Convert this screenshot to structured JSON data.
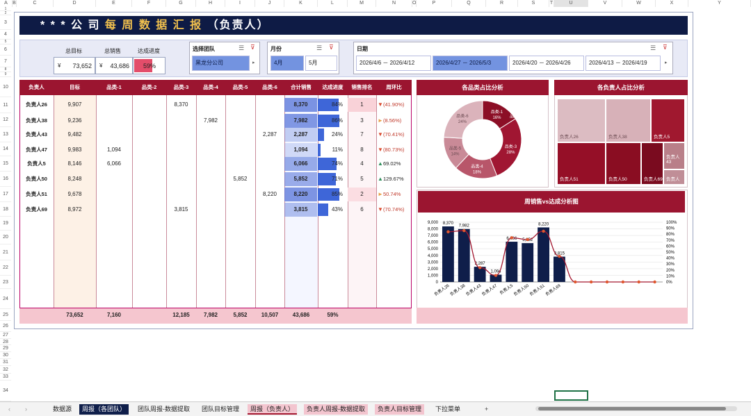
{
  "columns": [
    "A",
    "B",
    "C",
    "D",
    "E",
    "F",
    "G",
    "H",
    "I",
    "J",
    "K",
    "L",
    "M",
    "N",
    "O",
    "P",
    "Q",
    "R",
    "S",
    "T",
    "U",
    "V",
    "W",
    "X",
    "Y"
  ],
  "rows": [
    "1",
    "2",
    "3",
    "4",
    "5",
    "6",
    "7",
    "8",
    "9",
    "10",
    "11",
    "12",
    "13",
    "14",
    "15",
    "16",
    "17",
    "18",
    "19",
    "20",
    "21",
    "22",
    "23",
    "24",
    "25",
    "26",
    "27",
    "28",
    "29",
    "30",
    "31",
    "32",
    "33",
    "34"
  ],
  "title": {
    "stars": "* * * 公 司 ",
    "highlight": "每 周 数 据 汇 报",
    "suffix": "（负责人）"
  },
  "kpi": {
    "target_label": "总目标",
    "sales_label": "总销售",
    "progress_label": "达成进度",
    "currency": "¥",
    "target": "73,652",
    "sales": "43,686",
    "progress": "59%",
    "progress_value": 0.59
  },
  "team_slicer": {
    "title": "选择团队",
    "selected": "黑龙分公司"
  },
  "month_slicer": {
    "title": "月份",
    "items": [
      "4月",
      "5月"
    ],
    "selected": "4月"
  },
  "date_slicer": {
    "title": "日期",
    "items": [
      "2026/4/6 － 2026/4/12",
      "2026/4/27 － 2026/5/3",
      "2026/4/20 － 2026/4/26",
      "2026/4/13 － 2026/4/19"
    ],
    "selected": 1
  },
  "table": {
    "headers": [
      "负责人",
      "目标",
      "品类-1",
      "品类-2",
      "品类-3",
      "品类-4",
      "品类-5",
      "品类-6",
      "合计销售",
      "达成进度",
      "销售排名",
      "周环比"
    ],
    "rows": [
      {
        "name": "负责人26",
        "target": "9,907",
        "c1": "",
        "c2": "",
        "c3": "8,370",
        "c4": "",
        "c5": "",
        "c6": "",
        "total": "8,370",
        "pct": "84%",
        "pctv": 0.84,
        "rank": "1",
        "wow": "(41.90%)",
        "dir": "down"
      },
      {
        "name": "负责人38",
        "target": "9,236",
        "c1": "",
        "c2": "",
        "c3": "",
        "c4": "7,982",
        "c5": "",
        "c6": "",
        "total": "7,982",
        "pct": "86%",
        "pctv": 0.86,
        "rank": "3",
        "wow": "(8.56%)",
        "dir": "side"
      },
      {
        "name": "负责人43",
        "target": "9,482",
        "c1": "",
        "c2": "",
        "c3": "",
        "c4": "",
        "c5": "",
        "c6": "2,287",
        "total": "2,287",
        "pct": "24%",
        "pctv": 0.24,
        "rank": "7",
        "wow": "(70.41%)",
        "dir": "down"
      },
      {
        "name": "负责人47",
        "target": "9,983",
        "c1": "1,094",
        "c2": "",
        "c3": "",
        "c4": "",
        "c5": "",
        "c6": "",
        "total": "1,094",
        "pct": "11%",
        "pctv": 0.11,
        "rank": "8",
        "wow": "(80.73%)",
        "dir": "down"
      },
      {
        "name": "负责人5",
        "target": "8,146",
        "c1": "6,066",
        "c2": "",
        "c3": "",
        "c4": "",
        "c5": "",
        "c6": "",
        "total": "6,066",
        "pct": "74%",
        "pctv": 0.74,
        "rank": "4",
        "wow": "69.02%",
        "dir": "up"
      },
      {
        "name": "负责人50",
        "target": "8,248",
        "c1": "",
        "c2": "",
        "c3": "",
        "c4": "",
        "c5": "5,852",
        "c6": "",
        "total": "5,852",
        "pct": "71%",
        "pctv": 0.71,
        "rank": "5",
        "wow": "129.67%",
        "dir": "up"
      },
      {
        "name": "负责人51",
        "target": "9,678",
        "c1": "",
        "c2": "",
        "c3": "",
        "c4": "",
        "c5": "",
        "c6": "8,220",
        "total": "8,220",
        "pct": "85%",
        "pctv": 0.85,
        "rank": "2",
        "wow": "50.74%",
        "dir": "side"
      },
      {
        "name": "负责人69",
        "target": "8,972",
        "c1": "",
        "c2": "",
        "c3": "3,815",
        "c4": "",
        "c5": "",
        "c6": "",
        "total": "3,815",
        "pct": "43%",
        "pctv": 0.43,
        "rank": "6",
        "wow": "(70.74%)",
        "dir": "down"
      }
    ],
    "totals": {
      "target": "73,652",
      "c1": "7,160",
      "c2": "",
      "c3": "12,185",
      "c4": "7,982",
      "c5": "5,852",
      "c6": "10,507",
      "total": "43,686",
      "pct": "59%"
    }
  },
  "donut": {
    "title": "各品类占比分析",
    "slices": [
      {
        "label": "品类-1",
        "pct": "16%",
        "value": 0.16,
        "color": "#8c0f26"
      },
      {
        "label": "品类-2",
        "pct": "0%",
        "value": 0.0,
        "color": "#b3243d"
      },
      {
        "label": "品类-3",
        "pct": "28%",
        "value": 0.28,
        "color": "#a01632"
      },
      {
        "label": "品类-4",
        "pct": "18%",
        "value": 0.18,
        "color": "#b8566a"
      },
      {
        "label": "品类-5",
        "pct": "14%",
        "value": 0.14,
        "color": "#c98a97"
      },
      {
        "label": "品类-6",
        "pct": "24%",
        "value": 0.24,
        "color": "#dbb3bb"
      }
    ]
  },
  "treemap": {
    "title": "各负责人占比分析",
    "items": [
      {
        "label": "负责人26",
        "color": "#dcbcc2"
      },
      {
        "label": "负责人38",
        "color": "#d7b1b8"
      },
      {
        "label": "负责人5",
        "color": "#a0182f"
      },
      {
        "label": "负责人51",
        "color": "#950f27"
      },
      {
        "label": "负责人50",
        "color": "#8a0d22"
      },
      {
        "label": "负责人69",
        "color": "#7a0b1f"
      },
      {
        "label": "负责人 43",
        "color": "#b97f89"
      },
      {
        "label": "负责人",
        "color": "#c08e97"
      }
    ]
  },
  "chart_data": {
    "type": "bar",
    "title": "周销售vs达成分析图",
    "categories": [
      "负责人26",
      "负责人38",
      "负责人43",
      "负责人47",
      "负责人5",
      "负责人50",
      "负责人51",
      "负责人69",
      "",
      "",
      "",
      "",
      "",
      ""
    ],
    "series": [
      {
        "values": [
          8370,
          7982,
          2287,
          1094,
          6066,
          5852,
          8220,
          3815,
          0,
          0,
          0,
          0,
          0,
          0
        ]
      },
      {
        "values": [
          0.84,
          0.86,
          0.24,
          0.11,
          0.74,
          0.71,
          0.85,
          0.43,
          0,
          0,
          0,
          0,
          0,
          0
        ]
      }
    ],
    "bar_labels": [
      "8,370",
      "7,982",
      "2,287",
      "1,094",
      "6,066",
      "5,852",
      "8,220",
      "3,815"
    ],
    "y_ticks": [
      "9,000",
      "8,000",
      "7,000",
      "6,000",
      "5,000",
      "4,000",
      "3,000",
      "2,000",
      "1,000",
      "0"
    ],
    "y2_ticks": [
      "100%",
      "90%",
      "80%",
      "70%",
      "60%",
      "50%",
      "40%",
      "30%",
      "20%",
      "10%",
      "0%"
    ],
    "ylim": [
      0,
      9000
    ],
    "y2lim": [
      0,
      1
    ]
  },
  "tabs": [
    "数据源",
    "周报（各团队）",
    "团队周报-数据提取",
    "团队目标管理",
    "周报（负责人）",
    "负责人周报-数据提取",
    "负责人目标管理",
    "下拉菜单",
    "+"
  ],
  "nav": {
    "prev": "‹",
    "next": "›"
  }
}
